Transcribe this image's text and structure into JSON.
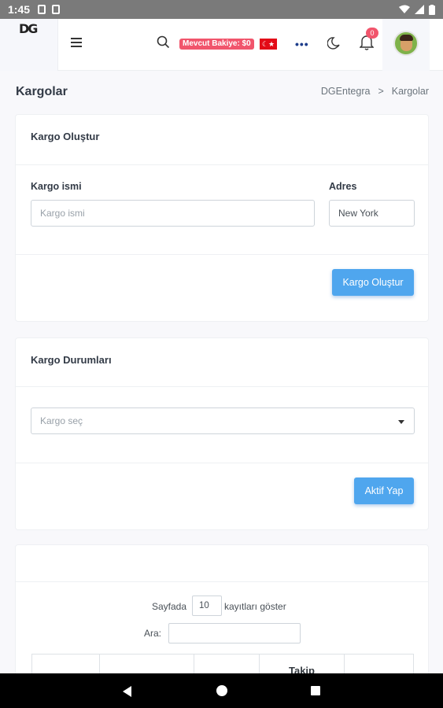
{
  "statusbar": {
    "time": "1:45"
  },
  "header": {
    "logo": "DG",
    "balance": "Mevcut Bakiye: $0",
    "flag_symbol": "☾★",
    "notification_count": "0"
  },
  "page": {
    "title": "Kargolar",
    "breadcrumb": {
      "root": "DGEntegra",
      "separator": ">",
      "current": "Kargolar"
    }
  },
  "create_card": {
    "title": "Kargo Oluştur",
    "name_label": "Kargo ismi",
    "name_placeholder": "Kargo ismi",
    "address_label": "Adres",
    "address_value": "New York",
    "submit_label": "Kargo Oluştur"
  },
  "status_card": {
    "title": "Kargo Durumları",
    "select_placeholder": "Kargo seç",
    "submit_label": "Aktif Yap"
  },
  "table_card": {
    "show_prefix": "Sayfada",
    "page_size": "10",
    "show_suffix": "kayıtları göster",
    "search_label": "Ara:",
    "search_value": "",
    "header_partial": "Takip"
  },
  "colors": {
    "primary": "#4fa6ee",
    "danger": "#f1556c"
  }
}
